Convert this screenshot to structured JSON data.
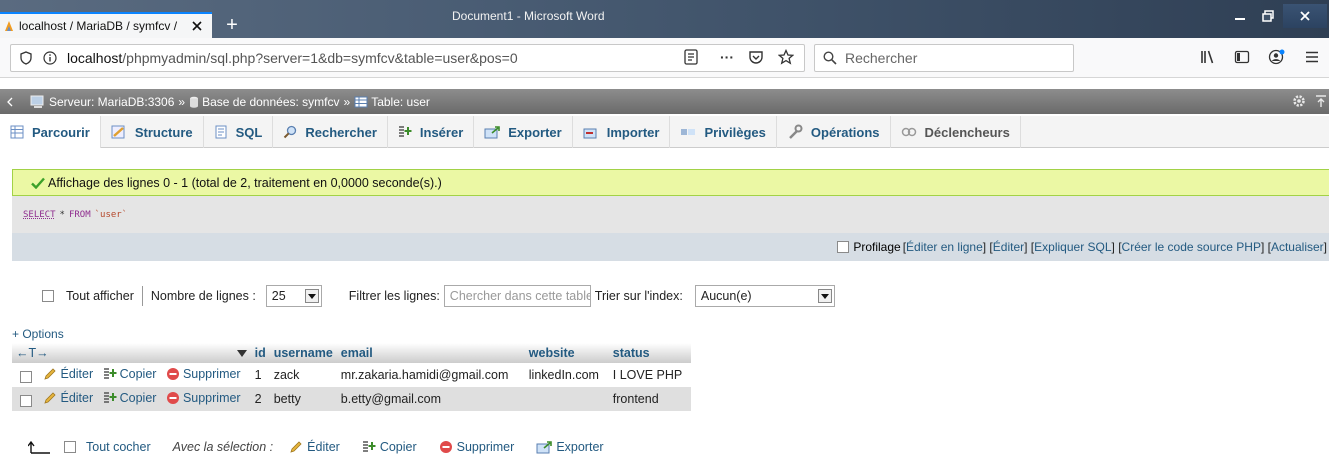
{
  "browser": {
    "tab_title": "localhost / MariaDB / symfcv /",
    "new_tab": "+",
    "word_title": "Document1 - Microsoft Word",
    "url_host": "localhost",
    "url_path": "/phpmyadmin/sql.php?server=1&db=symfcv&table=user&pos=0",
    "url_more": "···",
    "search_placeholder": "Rechercher"
  },
  "breadcrumb": {
    "server": "Serveur: MariaDB:3306",
    "database": "Base de données: symfcv",
    "table": "Table: user",
    "sep": "»"
  },
  "tabs": [
    {
      "label": "Parcourir"
    },
    {
      "label": "Structure"
    },
    {
      "label": "SQL"
    },
    {
      "label": "Rechercher"
    },
    {
      "label": "Insérer"
    },
    {
      "label": "Exporter"
    },
    {
      "label": "Importer"
    },
    {
      "label": "Privilèges"
    },
    {
      "label": "Opérations"
    },
    {
      "label": "Déclencheurs"
    }
  ],
  "message": "Affichage des lignes 0 - 1 (total de 2, traitement en 0,0000 seconde(s).)",
  "sql": {
    "select": "SELECT",
    "star": "*",
    "from": "FROM",
    "table": "`user`"
  },
  "sql_links": {
    "profilage": "Profilage",
    "edit_inline": "Éditer en ligne",
    "edit": "Éditer",
    "explain": "Expliquer SQL",
    "php": "Créer le code source PHP",
    "refresh": "Actualiser",
    "open": "[",
    "close": "]",
    "closeopen": "] ["
  },
  "controls": {
    "show_all": "Tout afficher",
    "rows_label": "Nombre de lignes :",
    "rows_value": "25",
    "filter_label": "Filtrer les lignes:",
    "filter_placeholder": "Chercher dans cette table",
    "sort_label": "Trier sur l'index:",
    "sort_value": "Aucun(e)"
  },
  "results": {
    "options": "+ Options",
    "nav_arrows": "←T→",
    "columns": [
      "id",
      "username",
      "email",
      "website",
      "status"
    ],
    "actions": {
      "edit": "Éditer",
      "copy": "Copier",
      "delete": "Supprimer"
    },
    "rows": [
      [
        "1",
        "zack",
        "mr.zakaria.hamidi@gmail.com",
        "linkedIn.com",
        "I LOVE PHP"
      ],
      [
        "2",
        "betty",
        "b.etty@gmail.com",
        "",
        "frontend"
      ]
    ]
  },
  "bottom": {
    "check_all": "Tout cocher",
    "with_selection": "Avec la sélection :",
    "edit": "Éditer",
    "copy": "Copier",
    "delete": "Supprimer",
    "export": "Exporter"
  }
}
